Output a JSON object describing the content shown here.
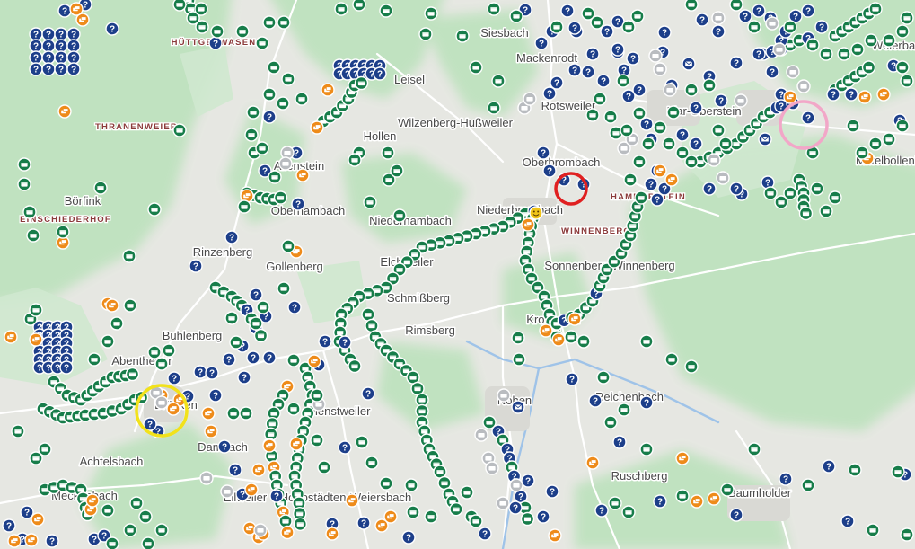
{
  "map": {
    "place_labels": [
      {
        "text": "Siesbach"
      },
      {
        "text": "Mackenrodt"
      },
      {
        "text": "Leisel"
      },
      {
        "text": "Rotsweiler"
      },
      {
        "text": "Idar-Oberstein"
      },
      {
        "text": "Weierbach"
      },
      {
        "text": "Wilzenberg-Hußweiler"
      },
      {
        "text": "Oberbrombach"
      },
      {
        "text": "Mittelbollenbach"
      },
      {
        "text": "Börfink"
      },
      {
        "text": "Hollen"
      },
      {
        "text": "Allenstein"
      },
      {
        "text": "Niederhambach"
      },
      {
        "text": "Oberhambach"
      },
      {
        "text": "Niederbrombach"
      },
      {
        "text": "Rinzenberg"
      },
      {
        "text": "Gollenberg"
      },
      {
        "text": "Elchweiler"
      },
      {
        "text": "Sonnenberg-Winnenberg"
      },
      {
        "text": "Schmißberg"
      },
      {
        "text": "Buhlenberg"
      },
      {
        "text": "Rimsberg"
      },
      {
        "text": "Kronweiler"
      },
      {
        "text": "Abentheuer"
      },
      {
        "text": "Reichenbach"
      },
      {
        "text": "Dienstweiler"
      },
      {
        "text": "Nohen"
      },
      {
        "text": "Achtelsbach"
      },
      {
        "text": "Ruschberg"
      },
      {
        "text": "Meckenbach"
      },
      {
        "text": "Baumholder"
      },
      {
        "text": "Hoppstädten-Weiersbach"
      },
      {
        "text": "Ellweiler"
      },
      {
        "text": "Dambach"
      },
      {
        "text": "Brücken"
      }
    ],
    "district_labels": [
      {
        "text": "HÜTTGESWASEN"
      },
      {
        "text": "THRANENWEIER"
      },
      {
        "text": "EINSCHIEDERHOF"
      },
      {
        "text": "WINNENBERG"
      },
      {
        "text": "HAMMERSTEIN"
      }
    ],
    "highlight_circles": [
      {
        "name": "red",
        "color": "#e02020"
      },
      {
        "name": "yellow",
        "color": "#f2e21a"
      },
      {
        "name": "pink",
        "color": "#f2a7c8"
      }
    ],
    "marker_types": [
      {
        "type": "geocache",
        "color": "#177d4a",
        "icon": "treasure-chest-icon"
      },
      {
        "type": "mystery",
        "color": "#1d3f8a",
        "icon": "question-mark-icon"
      },
      {
        "type": "multi",
        "color": "#ee8b1a",
        "icon": "multi-cache-icon"
      },
      {
        "type": "found",
        "color": "#b9bcc0",
        "icon": "found-cache-icon"
      },
      {
        "type": "letterbox",
        "color": "#1d3f8a",
        "icon": "envelope-icon"
      },
      {
        "type": "event",
        "color": "#f0c419",
        "icon": "smiley-icon"
      }
    ]
  }
}
